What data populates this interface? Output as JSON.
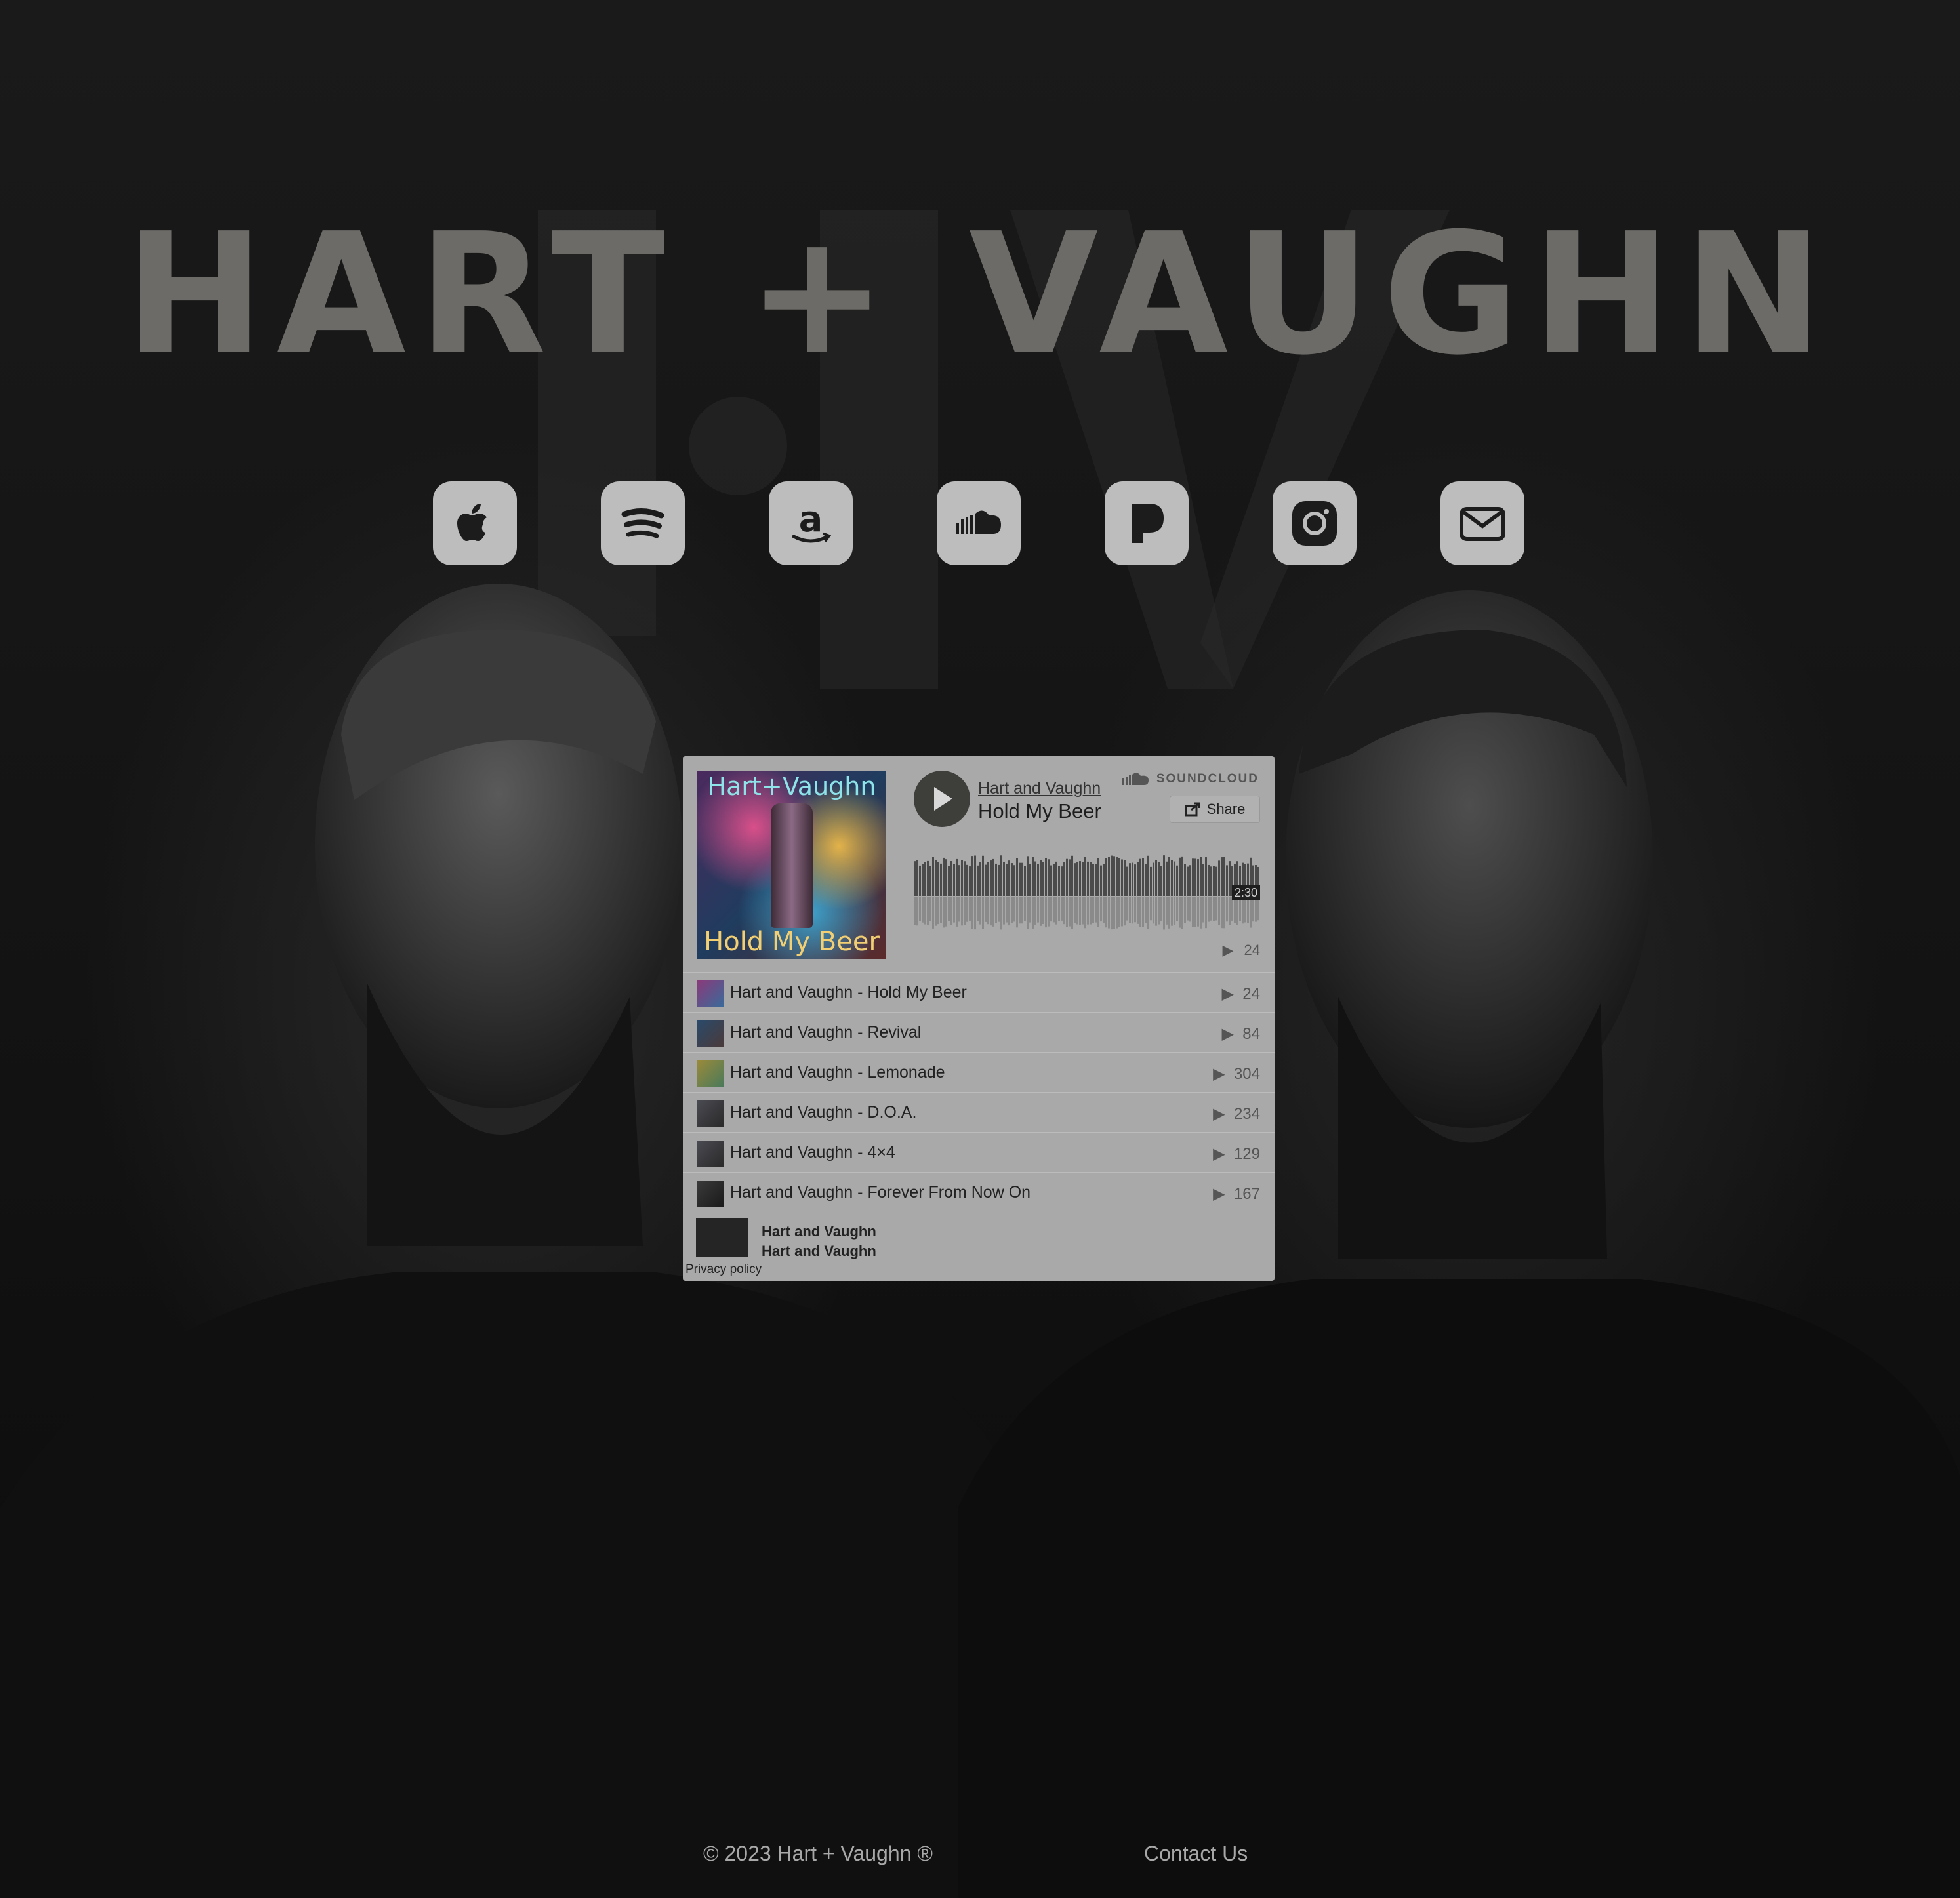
{
  "brand": {
    "logo_text": "HART + VAUGHN",
    "logo_color": "#6c6b67"
  },
  "social_links": [
    {
      "name": "apple-music",
      "icon": "apple-icon"
    },
    {
      "name": "spotify",
      "icon": "spotify-icon"
    },
    {
      "name": "amazon-music",
      "icon": "amazon-icon"
    },
    {
      "name": "soundcloud",
      "icon": "soundcloud-icon"
    },
    {
      "name": "pandora",
      "icon": "pandora-icon"
    },
    {
      "name": "instagram",
      "icon": "instagram-icon"
    },
    {
      "name": "email",
      "icon": "mail-icon"
    }
  ],
  "player": {
    "artwork_top_text": "Hart+Vaughn",
    "artwork_bottom_text": "Hold My Beer",
    "artist": "Hart and Vaughn",
    "current_track": "Hold My Beer",
    "brand_label": "SOUNDCLOUD",
    "share_label": "Share",
    "duration": "2:30",
    "plays": "24",
    "tracks": [
      {
        "title": "Hart and Vaughn - Hold My Beer",
        "plays": "24"
      },
      {
        "title": "Hart and Vaughn - Revival",
        "plays": "84"
      },
      {
        "title": "Hart and Vaughn - Lemonade",
        "plays": "304"
      },
      {
        "title": "Hart and Vaughn - D.O.A.",
        "plays": "234"
      },
      {
        "title": "Hart and Vaughn - 4×4",
        "plays": "129"
      },
      {
        "title": "Hart and Vaughn - Forever From Now On",
        "plays": "167"
      }
    ],
    "user_name": "Hart and Vaughn",
    "user_subname": "Hart and Vaughn",
    "privacy_label": "Privacy policy",
    "accent": "#3e3e3a",
    "background": "#a9a9a9"
  },
  "footer": {
    "copyright": "© 2023 Hart + Vaughn ®",
    "contact": "Contact Us"
  }
}
